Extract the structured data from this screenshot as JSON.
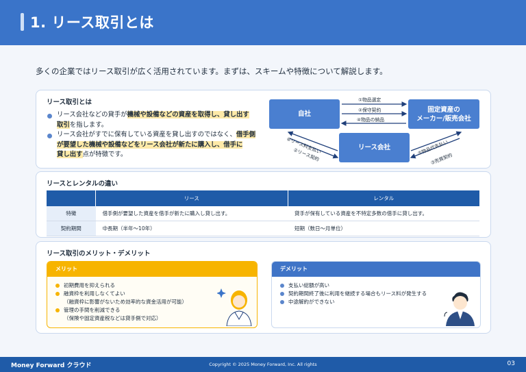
{
  "header": {
    "title": "1. リース取引とは"
  },
  "intro": "多くの企業ではリース取引が広く活用されています。まずは、スキームや特徴について解説します。",
  "section1": {
    "title": "リース取引とは",
    "bullets": [
      {
        "p1": "リース会社などの貸手が",
        "h1": "機械や設備などの資産を取得し、貸し出す",
        "p2": "",
        "line2h": "取引",
        "line2p": "を指します。"
      },
      {
        "p1": "リース会社がすでに保有している資産を貸し出すのではなく、",
        "h1": "借手側",
        "line2h": "が要望した機械や設備などをリース会社が新たに購入し、借手に",
        "line3h": "貸し出す",
        "line3p": "点が特徴です。"
      }
    ],
    "diagram": {
      "jisha": "自社",
      "maker": "固定資産の\nメーカー/販売会社",
      "lease": "リース会社",
      "a1": "①物品選定",
      "a2": "②保守契約",
      "a4": "④物品の納品",
      "a6": "⑥リース料支払い",
      "a2b": "②リース契約",
      "a5": "⑤物品代支払い",
      "a3": "③売買契約"
    }
  },
  "section2": {
    "title": "リースとレンタルの違い",
    "columns": [
      "",
      "リース",
      "レンタル"
    ],
    "rows": [
      [
        "特徴",
        "借手側が要望した資産を借手が新たに購入し貸し出す。",
        "貸手が保有している資産を不特定多数の借手に貸し出す。"
      ],
      [
        "契約期間",
        "中長期（半年〜10年）",
        "短期（数日〜月単位）"
      ]
    ]
  },
  "section3": {
    "title": "リース取引のメリット・デメリット",
    "merit": {
      "label": "メリット",
      "items": [
        "初期費用を抑えられる",
        "融資枠を利用しなくてよい",
        "（融資枠に影響がないため効率的な資金活用が可能）",
        "管理の手間を削減できる",
        "（保険や固定資産税などは貸手側で対応）"
      ]
    },
    "demerit": {
      "label": "デメリット",
      "items": [
        "支払い総額が高い",
        "契約期間終了後に利用を継続する場合もリース料が発生する",
        "中途解約ができない"
      ]
    }
  },
  "footer": {
    "logo": "Money Forward クラウド",
    "copyright": "Copyright © 2025 Money Forward, Inc. All rights",
    "page": "03"
  },
  "colors": {
    "header": "#3a74c9",
    "accent": "#1f5ba8",
    "merit": "#f7b400",
    "demerit": "#3f74c7",
    "highlight": "#fde9a8"
  }
}
